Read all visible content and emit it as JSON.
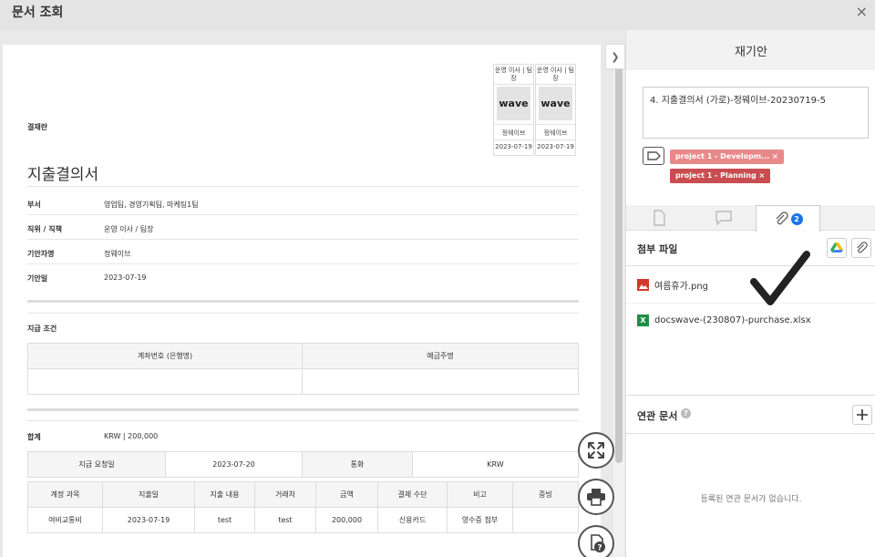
{
  "dialog": {
    "title": "문서 조회",
    "close_glyph": "×"
  },
  "document": {
    "approval_label": "결재란",
    "approvers": [
      {
        "role": "운영 이사 | 팀장",
        "stamp": "wave",
        "name": "정웨이브",
        "date": "2023-07-19"
      },
      {
        "role": "운영 이사 | 팀장",
        "stamp": "wave",
        "name": "정웨이브",
        "date": "2023-07-19"
      }
    ],
    "title": "지출결의서",
    "fields": [
      {
        "label": "부서",
        "value": "영업팀, 경영기획팀, 마케팅1팀"
      },
      {
        "label": "직위 / 직책",
        "value": "운영 이사 / 팀장"
      },
      {
        "label": "기안자명",
        "value": "정웨이브"
      },
      {
        "label": "기안일",
        "value": "2023-07-19"
      }
    ],
    "payment_terms_label": "지급 조건",
    "account_table": {
      "headers": [
        "계좌번호 (은행명)",
        "예금주명"
      ]
    },
    "total_label": "합계",
    "total_value": "KRW | 200,000",
    "request_table": {
      "cells": [
        "지급 요청일",
        "2023-07-20",
        "통화",
        "KRW"
      ]
    },
    "expense_table": {
      "headers": [
        "계정 과목",
        "지출일",
        "지출 내용",
        "거래처",
        "금액",
        "결제 수단",
        "비고",
        "증빙"
      ],
      "rows": [
        [
          "여비교통비",
          "2023-07-19",
          "test",
          "test",
          "200,000",
          "신용카드",
          "영수증 첨부",
          ""
        ]
      ]
    }
  },
  "side_panel": {
    "title": "재기안",
    "subject": "4. 지출결의서 (가로)-정웨이브-20230719-5",
    "tags": [
      {
        "label": "project 1 - Developm... ×",
        "color": "#e8898a"
      },
      {
        "label": "project 1 - Planning ×",
        "color": "#c94d50"
      }
    ],
    "attach_count": "2",
    "attachments_title": "첨부 파일",
    "files": [
      {
        "name": "여름휴가.png",
        "icon": "image-file-icon",
        "color": "#d23a2c"
      },
      {
        "name": "docswave-(230807)-purchase.xlsx",
        "icon": "excel-file-icon",
        "color": "#1f8f45"
      }
    ],
    "related_title": "연관 문서",
    "related_empty": "등록된 연관 문서가 없습니다."
  }
}
